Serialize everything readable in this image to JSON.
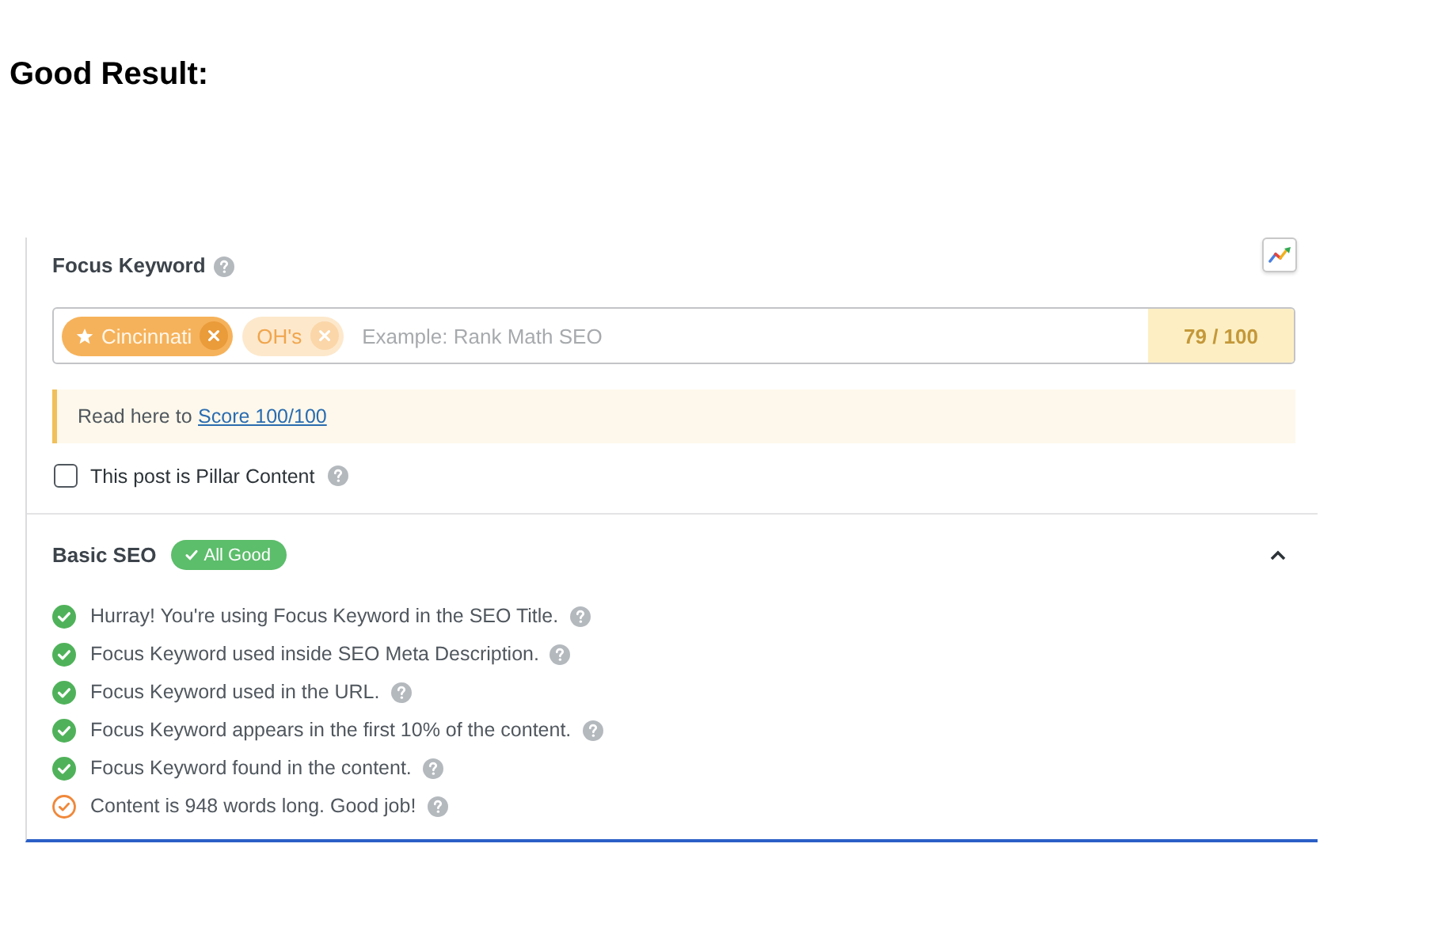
{
  "heading": "Good Result:",
  "focus_keyword": {
    "label": "Focus Keyword",
    "keywords": [
      {
        "text": "Cincinnati",
        "primary": true
      },
      {
        "text": "OH's",
        "primary": false
      }
    ],
    "placeholder": "Example: Rank Math SEO",
    "score": "79 / 100"
  },
  "notice": {
    "text": "Read here to",
    "link": "Score 100/100"
  },
  "pillar": {
    "label": "This post is Pillar Content",
    "checked": false
  },
  "basic_seo": {
    "title": "Basic SEO",
    "badge": "All Good",
    "expanded": true,
    "tests": [
      {
        "text": "Hurray! You're using Focus Keyword in the SEO Title.",
        "kind": "pass"
      },
      {
        "text": "Focus Keyword used inside SEO Meta Description.",
        "kind": "pass"
      },
      {
        "text": "Focus Keyword used in the URL.",
        "kind": "pass"
      },
      {
        "text": "Focus Keyword appears in the first 10% of the content.",
        "kind": "pass"
      },
      {
        "text": "Focus Keyword found in the content.",
        "kind": "pass"
      },
      {
        "text": "Content is 948 words long. Good job!",
        "kind": "warning"
      }
    ]
  }
}
